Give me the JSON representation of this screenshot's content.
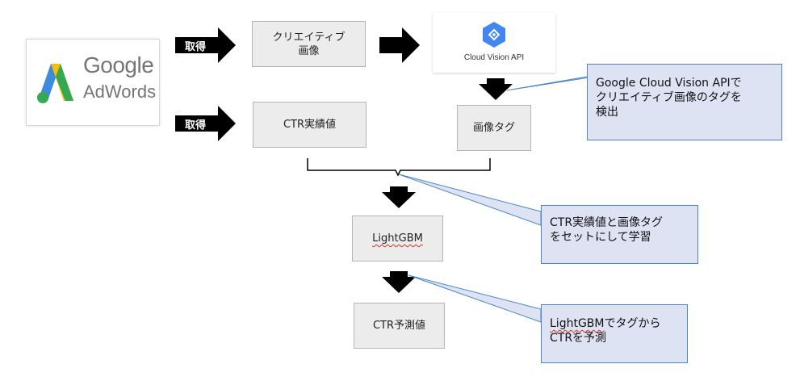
{
  "logo": {
    "line1": "Google",
    "line2": "AdWords"
  },
  "arrows": {
    "acquire_top": "取得",
    "acquire_bottom": "取得"
  },
  "boxes": {
    "creative_line1": "クリエイティブ",
    "creative_line2": "画像",
    "ctr_actual": "CTR実績値",
    "image_tag": "画像タグ",
    "lightgbm": "LightGBM",
    "ctr_predicted": "CTR予測値"
  },
  "vision": {
    "label": "Cloud Vision API"
  },
  "callouts": {
    "vision_line1": "Google Cloud Vision APIで",
    "vision_line2": "クリエイティブ画像のタグを",
    "vision_line3": "検出",
    "train_line1": "CTR実績値と画像タグ",
    "train_line2": "をセットにして学習",
    "predict_prefix": "LightGBM",
    "predict_line1_suffix": "でタグから",
    "predict_line2": "CTRを予測"
  },
  "colors": {
    "box_fill": "#ececec",
    "callout_fill": "#dde3f3",
    "callout_border": "#4a86c5",
    "vision_blue": "#4285f4"
  }
}
